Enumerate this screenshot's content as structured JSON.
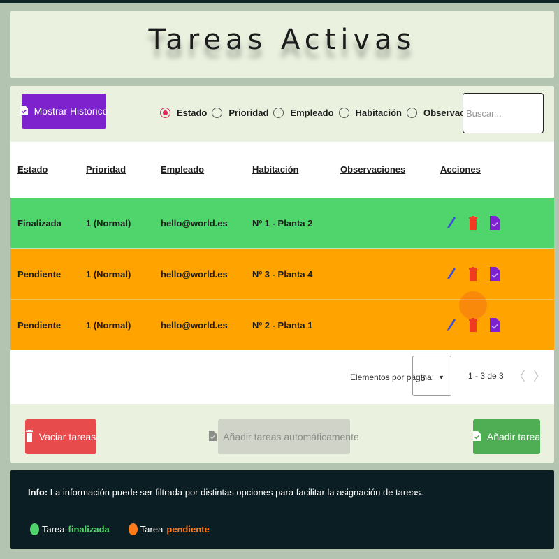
{
  "title": "Tareas Activas",
  "toolbar": {
    "historico_label": "Mostrar Histórico",
    "filters": [
      {
        "label": "Estado",
        "checked": true
      },
      {
        "label": "Prioridad",
        "checked": false
      },
      {
        "label": "Empleado",
        "checked": false
      },
      {
        "label": "Habitación",
        "checked": false
      },
      {
        "label": "Observaciones",
        "checked": false
      }
    ],
    "search_placeholder": "Buscar..."
  },
  "table": {
    "headers": [
      "Estado",
      "Prioridad",
      "Empleado",
      "Habitación",
      "Observaciones",
      "Acciones"
    ],
    "rows": [
      {
        "estado": "Finalizada",
        "prioridad": "1 (Normal)",
        "empleado": "hello@world.es",
        "habitacion": "Nº 1 - Planta 2",
        "observaciones": "",
        "status": "green"
      },
      {
        "estado": "Pendiente",
        "prioridad": "1 (Normal)",
        "empleado": "hello@world.es",
        "habitacion": "Nº 3 - Planta 4",
        "observaciones": "",
        "status": "orange"
      },
      {
        "estado": "Pendiente",
        "prioridad": "1 (Normal)",
        "empleado": "hello@world.es",
        "habitacion": "Nº 2 - Planta 1",
        "observaciones": "",
        "status": "orange"
      }
    ],
    "row_actions": [
      "edit-icon",
      "delete-icon",
      "complete-icon"
    ]
  },
  "pager": {
    "label": "Elementos por página:",
    "page_size": "5",
    "range": "1 - 3 de 3",
    "prev": "〈",
    "next": "〉"
  },
  "actions": {
    "vaciar_label": "Vaciar tareas",
    "auto_label": "Añadir tareas automáticamente",
    "anadir_label": "Añadir tarea"
  },
  "info": {
    "prefix": "Info:",
    "text": " La información puede ser filtrada por distintas opciones para facilitar la asignación de tareas.",
    "legend_word": "Tarea",
    "done_label": "finalizada",
    "pending_label": "pendiente"
  },
  "colors": {
    "finalizada": "#4fd56b",
    "pendiente": "#ffa300",
    "accent": "#7e22ce",
    "danger": "#e84b4b",
    "success": "#4fad54"
  }
}
